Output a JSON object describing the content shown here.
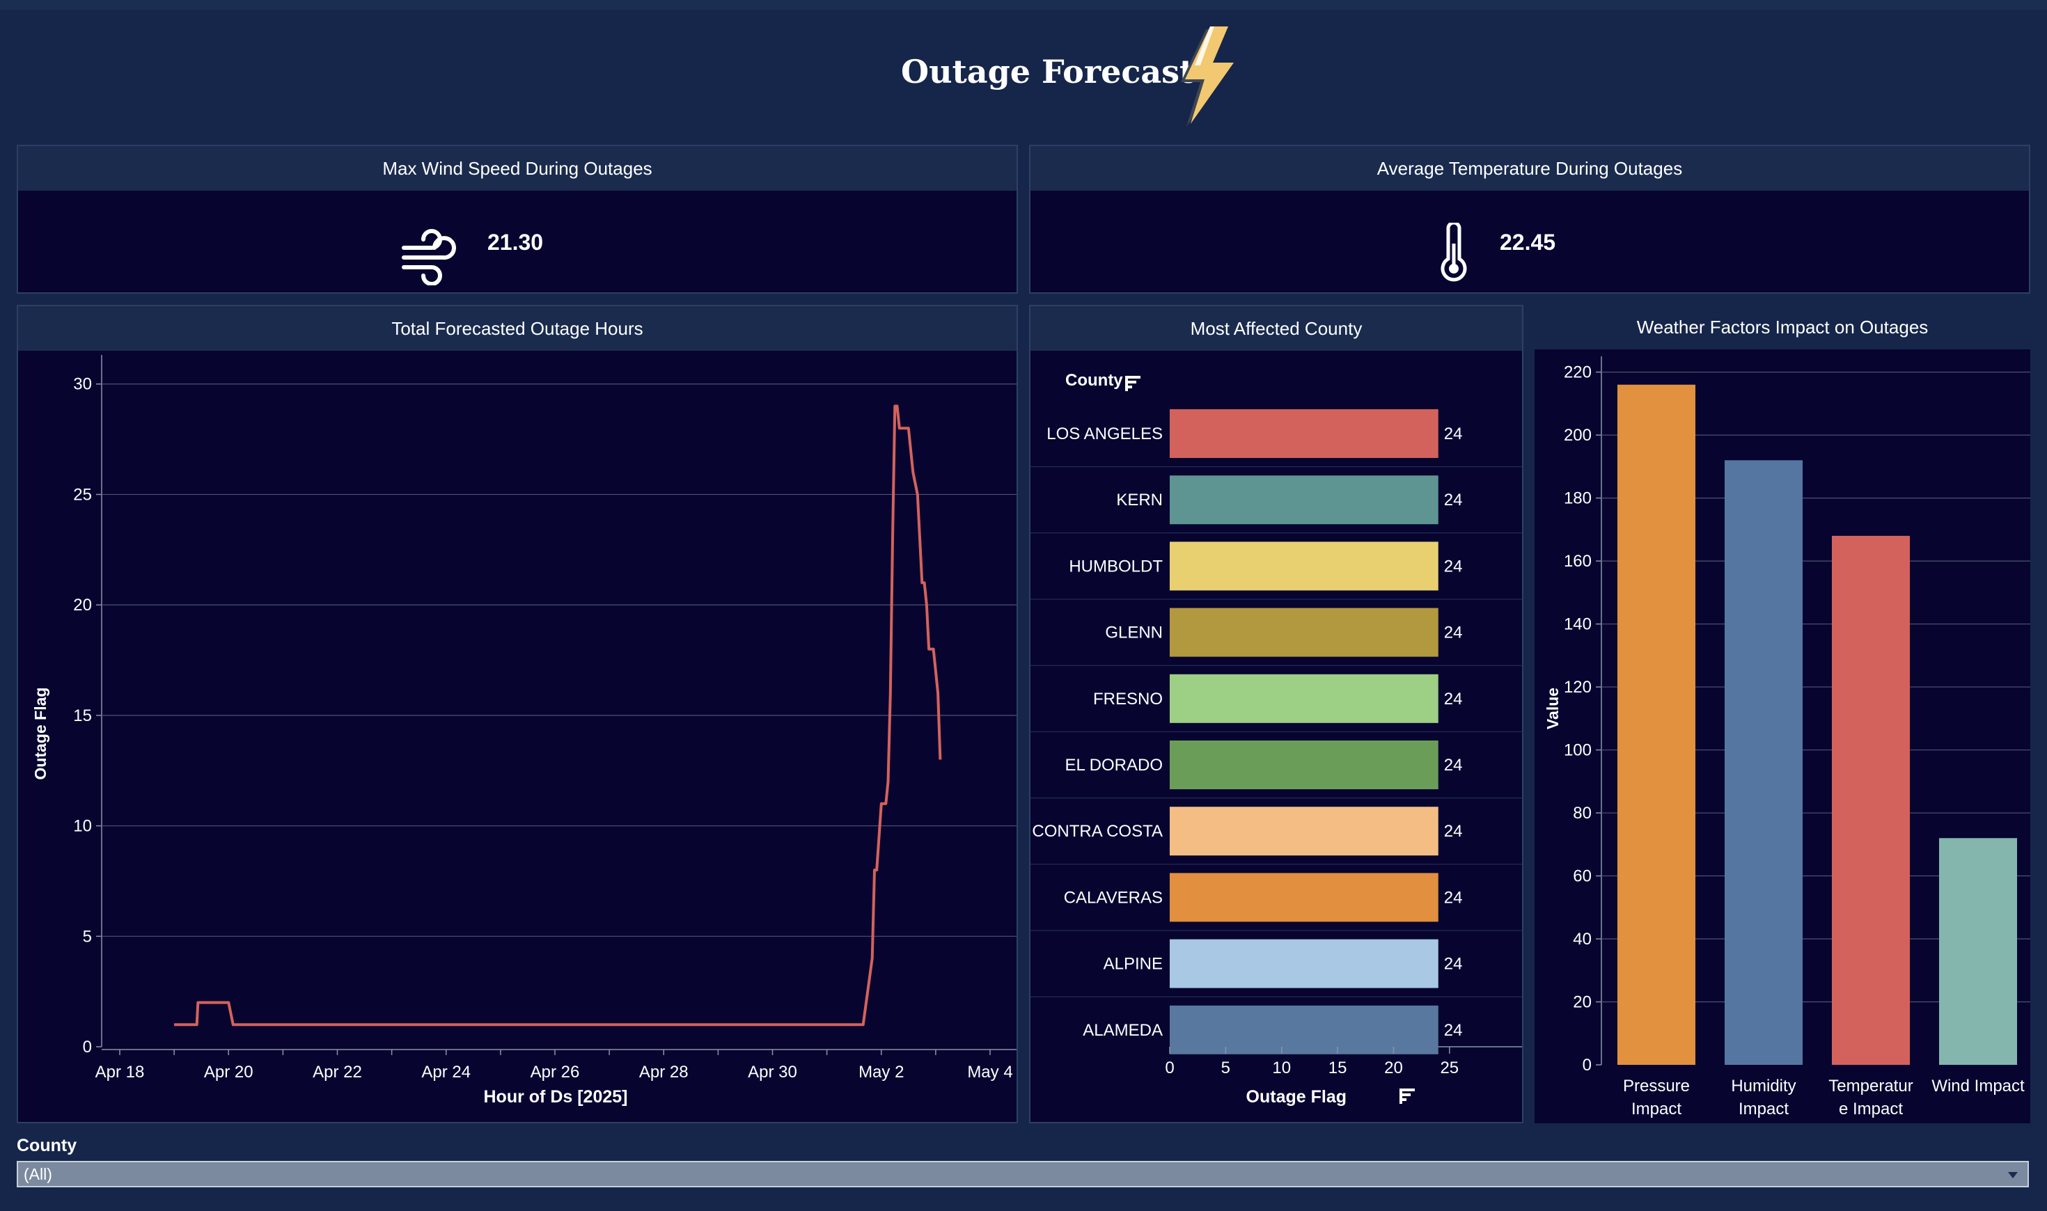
{
  "header": {
    "title": "Outage Forecast",
    "icon": "lightning-bolt-icon"
  },
  "kpis": {
    "wind": {
      "title": "Max Wind Speed During Outages",
      "value": "21.30",
      "icon": "wind-icon"
    },
    "temperature": {
      "title": "Average Temperature During Outages",
      "value": "22.45",
      "icon": "thermometer-icon"
    }
  },
  "line_panel": {
    "title": "Total Forecasted Outage Hours",
    "xlabel": "Hour of Ds [2025]",
    "ylabel": "Outage Flag"
  },
  "county_panel": {
    "title": "Most Affected County",
    "row_header": "County",
    "xlabel": "Outage Flag"
  },
  "weather_panel": {
    "title": "Weather Factors Impact on Outages",
    "ylabel": "Value"
  },
  "filter": {
    "label": "County",
    "value": "(All)"
  },
  "colors": {
    "background": "#16264a",
    "panel": "#070530",
    "panel_header": "#1a2b4e",
    "line": "#d4625c"
  },
  "chart_data": [
    {
      "type": "line",
      "title": "Total Forecasted Outage Hours",
      "xlabel": "Hour of Ds [2025]",
      "ylabel": "Outage Flag",
      "x_ticks": [
        "Apr 18",
        "Apr 20",
        "Apr 22",
        "Apr 24",
        "Apr 26",
        "Apr 28",
        "Apr 30",
        "May 2",
        "May 4"
      ],
      "y_ticks": [
        0,
        5,
        10,
        15,
        20,
        25,
        30
      ],
      "ylim": [
        0,
        31
      ],
      "grid": true,
      "series": [
        {
          "values": [
            [
              "Apr 19 00:00",
              1
            ],
            [
              "Apr 19 10:00",
              1
            ],
            [
              "Apr 19 10:30",
              2
            ],
            [
              "Apr 20 00:00",
              2
            ],
            [
              "Apr 20 02:00",
              1
            ],
            [
              "Apr 28 00:00",
              1
            ],
            [
              "May 1 16:00",
              1
            ],
            [
              "May 1 20:00",
              4
            ],
            [
              "May 1 21:00",
              8
            ],
            [
              "May 1 22:00",
              8
            ],
            [
              "May 2 00:00",
              11
            ],
            [
              "May 2 02:00",
              11
            ],
            [
              "May 2 03:00",
              12
            ],
            [
              "May 2 04:00",
              16
            ],
            [
              "May 2 05:00",
              23
            ],
            [
              "May 2 06:00",
              29
            ],
            [
              "May 2 07:00",
              29
            ],
            [
              "May 2 08:00",
              28
            ],
            [
              "May 2 12:00",
              28
            ],
            [
              "May 2 14:00",
              26
            ],
            [
              "May 2 16:00",
              25
            ],
            [
              "May 2 18:00",
              21
            ],
            [
              "May 2 19:00",
              21
            ],
            [
              "May 2 20:00",
              20
            ],
            [
              "May 2 21:00",
              18
            ],
            [
              "May 2 23:00",
              18
            ],
            [
              "May 3 00:00",
              17
            ],
            [
              "May 3 01:00",
              16
            ],
            [
              "May 3 02:00",
              13
            ]
          ]
        }
      ]
    },
    {
      "type": "bar",
      "orientation": "horizontal",
      "title": "Most Affected County",
      "xlabel": "Outage Flag",
      "x_ticks": [
        0,
        5,
        10,
        15,
        20,
        25
      ],
      "xlim": [
        0,
        27.5
      ],
      "categories": [
        "LOS ANGELES",
        "KERN",
        "HUMBOLDT",
        "GLENN",
        "FRESNO",
        "EL DORADO",
        "CONTRA COSTA",
        "CALAVERAS",
        "ALPINE",
        "ALAMEDA"
      ],
      "values": [
        24,
        24,
        24,
        24,
        24,
        24,
        24,
        24,
        24,
        24
      ],
      "labels": [
        "24",
        "24",
        "24",
        "24",
        "24",
        "24",
        "24",
        "24",
        "24",
        "24"
      ],
      "colors": [
        "#d4625c",
        "#5e9592",
        "#e8d071",
        "#b2993f",
        "#9dcf84",
        "#6a9e58",
        "#f3bd84",
        "#e28f3f",
        "#a8c8e4",
        "#5878a0"
      ]
    },
    {
      "type": "bar",
      "title": "Weather Factors Impact on Outages",
      "ylabel": "Value",
      "y_ticks": [
        0,
        20,
        40,
        60,
        80,
        100,
        120,
        140,
        160,
        180,
        200,
        220
      ],
      "ylim": [
        0,
        225
      ],
      "categories": [
        [
          "Pressure",
          "Impact"
        ],
        [
          "Humidity",
          "Impact"
        ],
        [
          "Temperatur",
          "e Impact"
        ],
        [
          "Wind Impact"
        ]
      ],
      "values": [
        216,
        192,
        168,
        72
      ],
      "colors": [
        "#e2913f",
        "#5576a0",
        "#d4625c",
        "#84b6ae"
      ]
    }
  ]
}
